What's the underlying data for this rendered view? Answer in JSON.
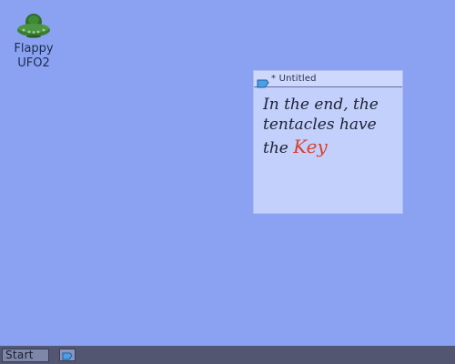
{
  "desktop": {
    "background_color": "#8aa2f1",
    "icons": [
      {
        "icon": "ufo-icon",
        "label": "Flappy\nUFO2"
      }
    ]
  },
  "note_window": {
    "title": "* Untitled",
    "title_icon": "note-icon",
    "content": {
      "line1": "In the end, the",
      "line2": "tentacles have",
      "line3_prefix": "the ",
      "line3_highlight": "Key"
    },
    "colors": {
      "ink": "#1d2233",
      "highlight_ink": "#d4432e",
      "paper": "#c3d0fb"
    }
  },
  "taskbar": {
    "start_label": "Start",
    "tasks": [
      {
        "icon": "note-icon"
      }
    ],
    "color": "#525671"
  }
}
